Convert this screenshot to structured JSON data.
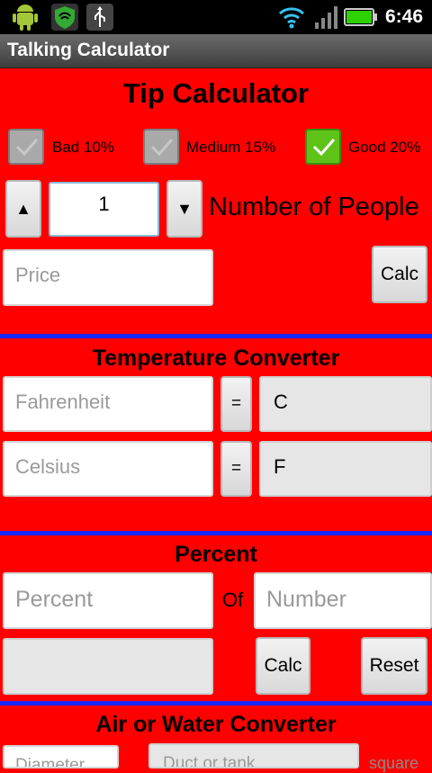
{
  "status_bar": {
    "time": "6:46"
  },
  "app_title": "Talking Calculator",
  "tip": {
    "title": "Tip Calculator",
    "options": [
      {
        "label": "Bad 10%",
        "checked": false
      },
      {
        "label": "Medium 15%",
        "checked": false
      },
      {
        "label": "Good 20%",
        "checked": true
      }
    ],
    "people_value": "1",
    "people_label": "Number of People",
    "up_symbol": "▲",
    "down_symbol": "▼",
    "price_placeholder": "Price",
    "calc_label": "Calc"
  },
  "temperature": {
    "title": "Temperature Converter",
    "fahrenheit_placeholder": "Fahrenheit",
    "celsius_placeholder": "Celsius",
    "equals_label": "=",
    "c_result": "C",
    "f_result": "F"
  },
  "percent": {
    "title": "Percent",
    "percent_placeholder": "Percent",
    "of_label": "Of",
    "number_placeholder": "Number",
    "result": "",
    "calc_label": "Calc",
    "reset_label": "Reset"
  },
  "air_water": {
    "title": "Air or Water Converter",
    "diameter_placeholder": "Diameter",
    "duct_placeholder": "Duct or tank",
    "square_label": "square"
  }
}
